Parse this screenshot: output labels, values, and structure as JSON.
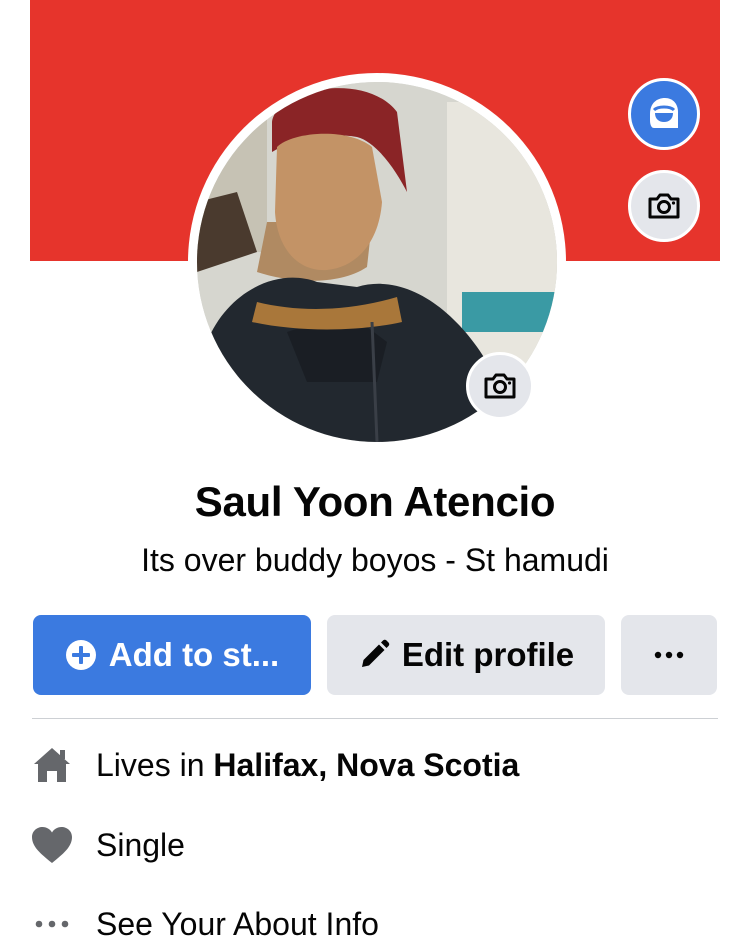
{
  "profile": {
    "name": "Saul Yoon Atencio",
    "bio": "Its over buddy boyos - St hamudi",
    "cover_color": "#e6342c"
  },
  "actions": {
    "add_story": "Add to st...",
    "edit_profile": "Edit profile",
    "more": "..."
  },
  "info": {
    "lives_prefix": "Lives in",
    "lives_city": "Halifax, Nova Scotia",
    "relationship": "Single",
    "about": "See Your About Info"
  },
  "icons": {
    "avatar": "avatar-face-icon",
    "cover_camera": "camera-icon",
    "photo_camera": "camera-icon",
    "add": "plus-circle-icon",
    "edit": "pencil-icon",
    "home": "home-icon",
    "heart": "heart-icon",
    "dots": "ellipsis-icon"
  },
  "colors": {
    "accent": "#3b7ae0",
    "secondary_button": "#e4e6eb",
    "icon_gray": "#65676b"
  }
}
